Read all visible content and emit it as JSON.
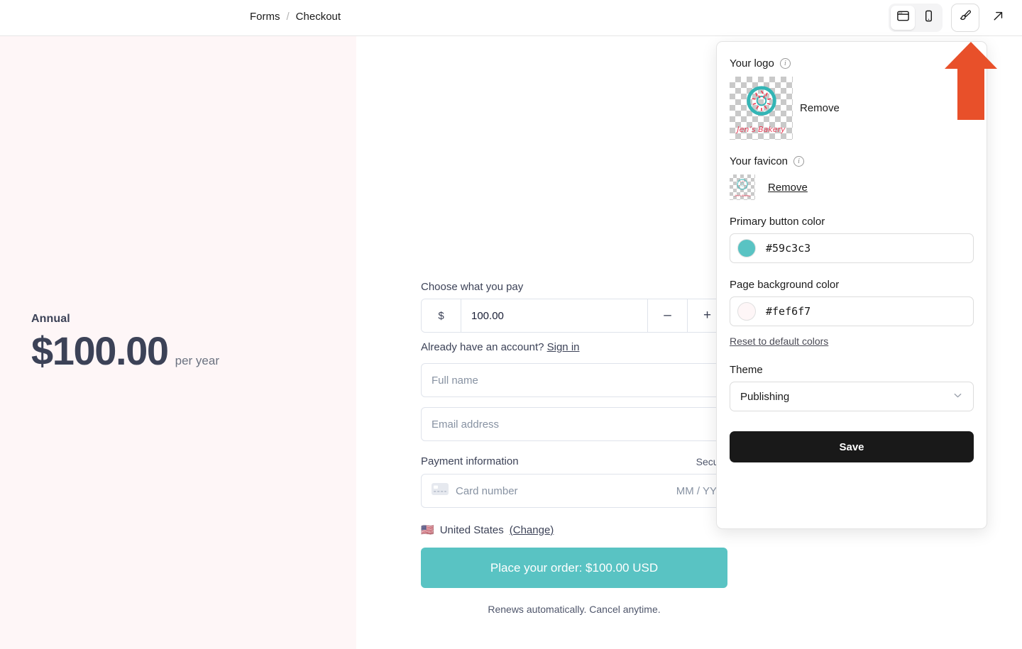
{
  "breadcrumb": {
    "root": "Forms",
    "separator": "/",
    "current": "Checkout"
  },
  "toolbar": {
    "desktop_icon": "desktop-preview-icon",
    "mobile_icon": "mobile-preview-icon",
    "brush_icon": "brush-branding-icon",
    "external_icon": "open-external-icon"
  },
  "left_panel": {
    "plan_name": "Annual",
    "price": "$100.00",
    "period": "per year",
    "background_color": "#fef6f7"
  },
  "checkout": {
    "amount_label": "Choose what you pay",
    "currency_symbol": "$",
    "amount_value": "100.00",
    "decrement_label": "–",
    "increment_label": "+",
    "account_prompt": "Already have an account?",
    "signin_label": "Sign in",
    "full_name_placeholder": "Full name",
    "email_placeholder": "Email address",
    "payment_label": "Payment information",
    "secure_label": "Secure",
    "card_icon": "credit-card-icon",
    "card_placeholder": "Card number",
    "expiry_placeholder": "MM / YY",
    "country_flag": "🇺🇸",
    "country_name": "United States",
    "change_label": "(Change)",
    "order_button_label": "Place your order: $100.00 USD",
    "order_button_color": "#59c3c3",
    "renew_note": "Renews automatically. Cancel anytime."
  },
  "brand_panel": {
    "logo_label": "Your logo",
    "logo_info_icon": "info-icon",
    "logo_brand_text": "Jen’s Bakery",
    "logo_remove_label": "Remove",
    "favicon_label": "Your favicon",
    "favicon_info_icon": "info-icon",
    "favicon_brand_text": "Jen’s Bakery",
    "favicon_remove_label": "Remove",
    "primary_color_label": "Primary button color",
    "primary_color_value": "#59c3c3",
    "page_bg_label": "Page background color",
    "page_bg_value": "#fef6f7",
    "reset_label": "Reset to default colors",
    "theme_label": "Theme",
    "theme_value": "Publishing",
    "theme_chevron_icon": "chevron-down-icon",
    "save_label": "Save"
  },
  "annotation": {
    "arrow_icon": "up-arrow-annotation",
    "color": "#e8502a"
  }
}
